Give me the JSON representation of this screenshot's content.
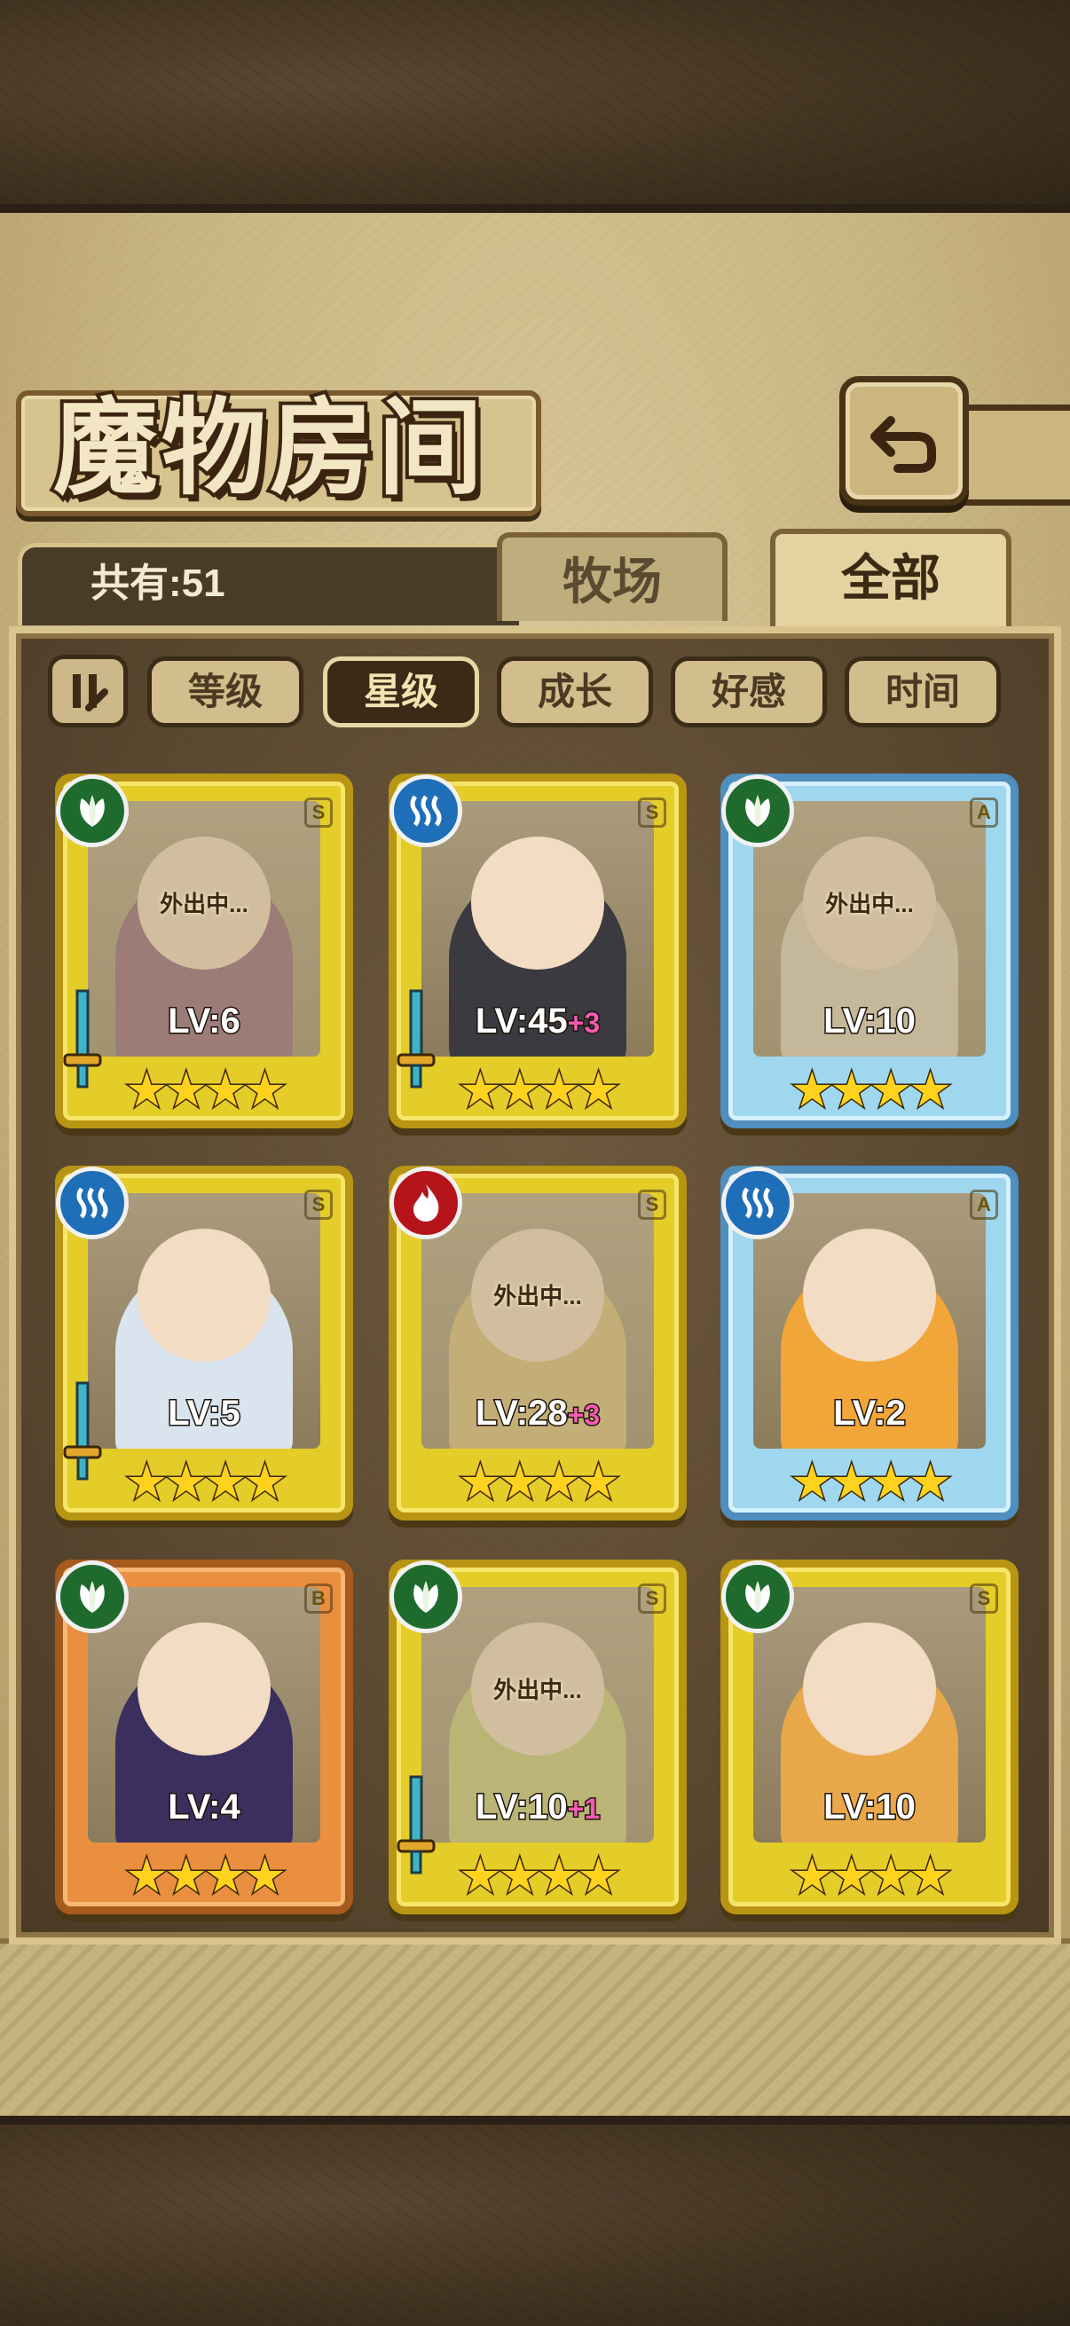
{
  "header": {
    "title": "魔物房间",
    "count_label": "共有:51"
  },
  "tabs": [
    {
      "label": "牧场",
      "active": false
    },
    {
      "label": "全部",
      "active": true
    }
  ],
  "sort_buttons": [
    {
      "label": "等级",
      "active": false
    },
    {
      "label": "星级",
      "active": true
    },
    {
      "label": "成长",
      "active": false
    },
    {
      "label": "好感",
      "active": false
    },
    {
      "label": "时间",
      "active": false
    }
  ],
  "cards": [
    {
      "element": "leaf",
      "rank": "S",
      "level": "LV:6",
      "bonus": "",
      "stars": "★★★★",
      "away": "外出中...",
      "weapon": true,
      "color": "#7d4b6a"
    },
    {
      "element": "water",
      "rank": "S",
      "level": "LV:45",
      "bonus": "+3",
      "stars": "★★★★",
      "away": "",
      "weapon": true,
      "color": "#3b3a40"
    },
    {
      "element": "leaf",
      "rank": "A",
      "level": "LV:10",
      "bonus": "",
      "stars": "★★★★",
      "away": "外出中...",
      "weapon": false,
      "color": "#d9cdb5"
    },
    {
      "element": "water",
      "rank": "S",
      "level": "LV:5",
      "bonus": "",
      "stars": "★★★★",
      "away": "",
      "weapon": true,
      "color": "#d9e4ef"
    },
    {
      "element": "fire",
      "rank": "S",
      "level": "LV:28",
      "bonus": "+3",
      "stars": "★★★★",
      "away": "外出中...",
      "weapon": false,
      "color": "#d8b96a"
    },
    {
      "element": "water",
      "rank": "A",
      "level": "LV:2",
      "bonus": "",
      "stars": "★★★★",
      "away": "",
      "weapon": false,
      "color": "#f1a63a"
    },
    {
      "element": "leaf",
      "rank": "B",
      "level": "LV:4",
      "bonus": "",
      "stars": "★★★★",
      "away": "",
      "weapon": false,
      "color": "#3b2f5e"
    },
    {
      "element": "leaf",
      "rank": "S",
      "level": "LV:10",
      "bonus": "+1",
      "stars": "★★★★",
      "away": "外出中...",
      "weapon": true,
      "color": "#c2c66a"
    },
    {
      "element": "leaf",
      "rank": "S",
      "level": "LV:10",
      "bonus": "",
      "stars": "★★★★",
      "away": "",
      "weapon": false,
      "color": "#e8a84a"
    }
  ],
  "icons": {
    "back": "back-arrow-icon",
    "sort_toggle": "sort-order-icon",
    "element_leaf": "leaf-element-icon",
    "element_water": "water-element-icon",
    "element_fire": "fire-element-icon",
    "weapon": "sword-icon"
  }
}
